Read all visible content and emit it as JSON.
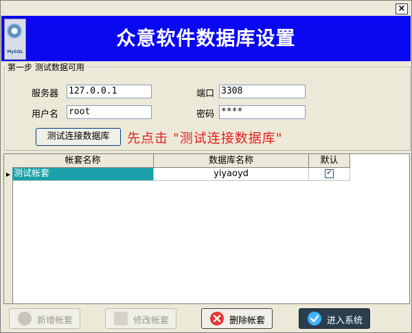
{
  "window": {
    "close_glyph": "×"
  },
  "banner": {
    "title": "众意软件数据库设置",
    "logo_text": "MySQL"
  },
  "group": {
    "legend": "第一步 测试数据可用",
    "server_label": "服务器",
    "server_value": "127.0.0.1",
    "port_label": "端口",
    "port_value": "3308",
    "user_label": "用户名",
    "user_value": "root",
    "password_label": "密码",
    "password_value": "****",
    "test_button": "测试连接数据库",
    "hint": "先点击 \"测试连接数据库\""
  },
  "grid": {
    "headers": [
      "帐套名称",
      "数据库名称",
      "默认"
    ],
    "rows": [
      {
        "account": "测试帐套",
        "database": "yiyaoyd",
        "default_checked": true
      }
    ],
    "row_indicator": "▶",
    "check_glyph": "✓"
  },
  "buttons": {
    "add": "新增帐套",
    "edit": "修改帐套",
    "delete": "删除帐套",
    "enter": "进入系统"
  },
  "icons": {
    "close": "close-icon",
    "logo": "mysql-gear-icon",
    "add": "add-circle-icon",
    "edit": "edit-icon",
    "delete": "delete-x-icon",
    "enter": "check-circle-icon"
  },
  "colors": {
    "banner_bg": "#0a08f0",
    "hint_text": "#e81f1f",
    "selected_row": "#1aa0a8"
  }
}
